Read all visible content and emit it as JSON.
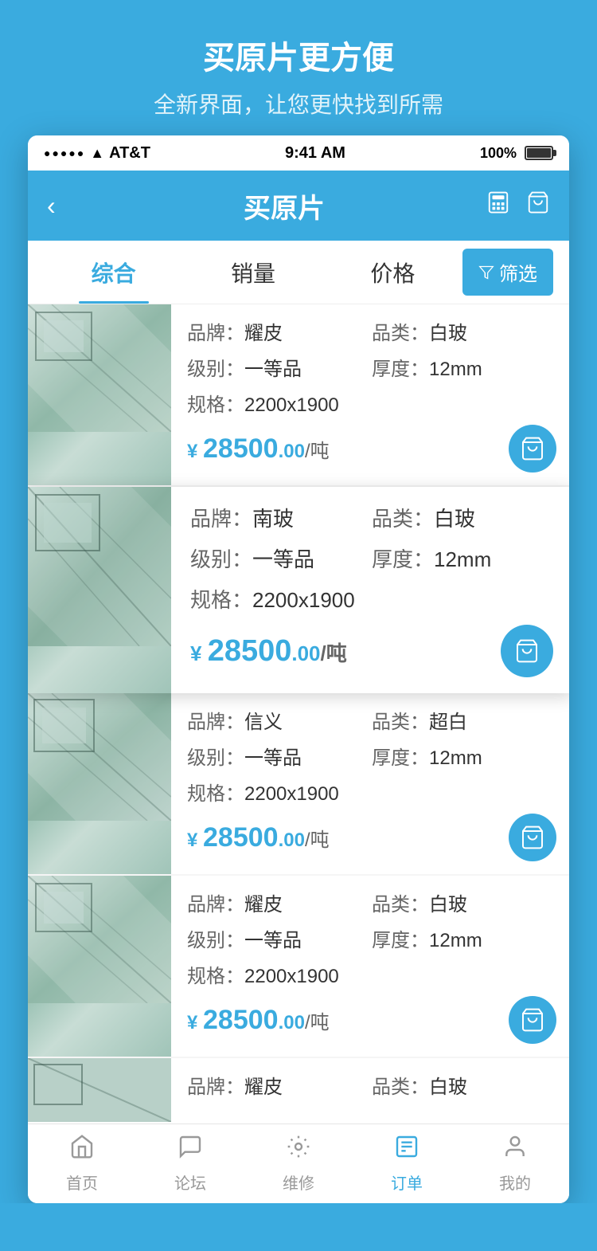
{
  "header": {
    "title": "买原片更方便",
    "subtitle": "全新界面，让您更快找到所需"
  },
  "status_bar": {
    "carrier": "AT&T",
    "time": "9:41 AM",
    "battery": "100%"
  },
  "nav": {
    "back_label": "‹",
    "title": "买原片",
    "icon_calc": "calculator",
    "icon_cart": "cart"
  },
  "sort_tabs": [
    {
      "label": "综合",
      "active": true
    },
    {
      "label": "销量",
      "active": false
    },
    {
      "label": "价格",
      "active": false
    }
  ],
  "filter_btn": "筛选",
  "products": [
    {
      "brand_label": "品牌：",
      "brand_value": "耀皮",
      "category_label": "品类：",
      "category_value": "白玻",
      "grade_label": "级别：",
      "grade_value": "一等品",
      "thickness_label": "厚度：",
      "thickness_value": "12mm",
      "size_label": "规格：",
      "size_value": "2200x1900",
      "price_int": "28500",
      "price_dec": "00",
      "price_unit": "/吨",
      "highlighted": false
    },
    {
      "brand_label": "品牌：",
      "brand_value": "南玻",
      "category_label": "品类：",
      "category_value": "白玻",
      "grade_label": "级别：",
      "grade_value": "一等品",
      "thickness_label": "厚度：",
      "thickness_value": "12mm",
      "size_label": "规格：",
      "size_value": "2200x1900",
      "price_int": "28500",
      "price_dec": "00",
      "price_unit": "/吨",
      "highlighted": true
    },
    {
      "brand_label": "品牌：",
      "brand_value": "信义",
      "category_label": "品类：",
      "category_value": "超白",
      "grade_label": "级别：",
      "grade_value": "一等品",
      "thickness_label": "厚度：",
      "thickness_value": "12mm",
      "size_label": "规格：",
      "size_value": "2200x1900",
      "price_int": "28500",
      "price_dec": "00",
      "price_unit": "/吨",
      "highlighted": false
    },
    {
      "brand_label": "品牌：",
      "brand_value": "耀皮",
      "category_label": "品类：",
      "category_value": "白玻",
      "grade_label": "级别：",
      "grade_value": "一等品",
      "thickness_label": "厚度：",
      "thickness_value": "12mm",
      "size_label": "规格：",
      "size_value": "2200x1900",
      "price_int": "28500",
      "price_dec": "00",
      "price_unit": "/吨",
      "highlighted": false
    },
    {
      "brand_label": "品牌：",
      "brand_value": "耀皮",
      "category_label": "品类：",
      "category_value": "白玻",
      "grade_label": "级别：",
      "grade_value": "",
      "thickness_label": "",
      "thickness_value": "",
      "size_label": "",
      "size_value": "",
      "price_int": "",
      "price_dec": "",
      "price_unit": "",
      "highlighted": false,
      "partial": true
    }
  ],
  "tabs": [
    {
      "label": "首页",
      "icon": "home",
      "active": false
    },
    {
      "label": "论坛",
      "icon": "forum",
      "active": false
    },
    {
      "label": "维修",
      "icon": "repair",
      "active": false
    },
    {
      "label": "订单",
      "icon": "order",
      "active": true
    },
    {
      "label": "我的",
      "icon": "profile",
      "active": false
    }
  ]
}
